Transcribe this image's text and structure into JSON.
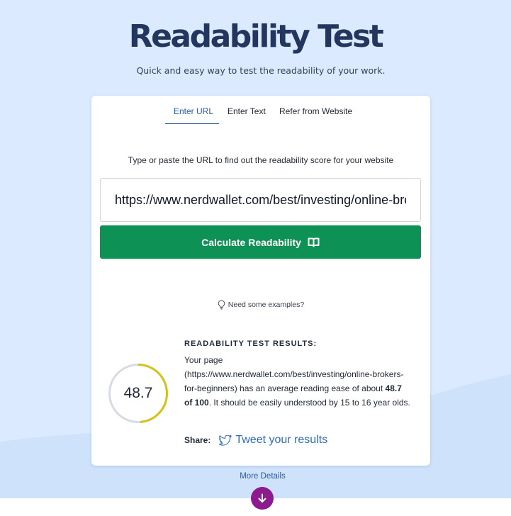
{
  "hero": {
    "title": "Readability Test",
    "subtitle": "Quick and easy way to test the readability of your work."
  },
  "tabs": [
    {
      "label": "Enter URL",
      "active": true
    },
    {
      "label": "Enter Text",
      "active": false
    },
    {
      "label": "Refer from Website",
      "active": false
    }
  ],
  "form": {
    "instruction": "Type or paste the URL to find out the readability score for your website",
    "url_value": "https://www.nerdwallet.com/best/investing/online-brokers-for-beginners",
    "submit_label": "Calculate Readability",
    "submit_icon": "book-open-icon"
  },
  "examples": {
    "label": "Need some examples?",
    "icon": "lightbulb-icon"
  },
  "results": {
    "heading": "READABILITY TEST RESULTS:",
    "score": "48.7",
    "score_fraction": 0.487,
    "intro": "Your page (https://www.nerdwallet.com/best/investing/online-brokers-for-beginners) has an average reading ease of about ",
    "score_phrase": "48.7 of 100",
    "outro": ". It should be easily understood by 15 to 16 year olds.",
    "share_label": "Share:",
    "tweet_label": "Tweet your results"
  },
  "footer": {
    "more_label": "More Details",
    "more_icon": "arrow-down-icon"
  },
  "colors": {
    "background": "#dbeafe",
    "title": "#23365e",
    "accent_blue": "#2f5a9c",
    "button_green": "#0e9155",
    "gauge_fill": "#d4c21a",
    "gauge_track": "#d6dbe5",
    "more_button": "#8e1b8e"
  }
}
